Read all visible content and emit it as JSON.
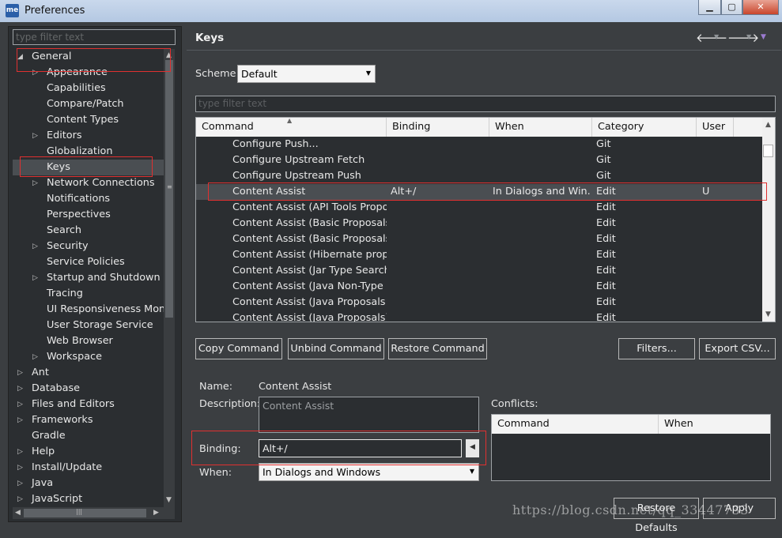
{
  "window": {
    "title": "Preferences",
    "app_icon": "me"
  },
  "left": {
    "filter_placeholder": "type filter text",
    "tree": [
      {
        "label": "General",
        "level": 0,
        "expanded": true,
        "arrow": "◢"
      },
      {
        "label": "Appearance",
        "level": 1,
        "arrow": "▷"
      },
      {
        "label": "Capabilities",
        "level": 1,
        "arrow": ""
      },
      {
        "label": "Compare/Patch",
        "level": 1,
        "arrow": ""
      },
      {
        "label": "Content Types",
        "level": 1,
        "arrow": ""
      },
      {
        "label": "Editors",
        "level": 1,
        "arrow": "▷"
      },
      {
        "label": "Globalization",
        "level": 1,
        "arrow": ""
      },
      {
        "label": "Keys",
        "level": 1,
        "arrow": "",
        "selected": true
      },
      {
        "label": "Network Connections",
        "level": 1,
        "arrow": "▷"
      },
      {
        "label": "Notifications",
        "level": 1,
        "arrow": ""
      },
      {
        "label": "Perspectives",
        "level": 1,
        "arrow": ""
      },
      {
        "label": "Search",
        "level": 1,
        "arrow": ""
      },
      {
        "label": "Security",
        "level": 1,
        "arrow": "▷"
      },
      {
        "label": "Service Policies",
        "level": 1,
        "arrow": ""
      },
      {
        "label": "Startup and Shutdown",
        "level": 1,
        "arrow": "▷"
      },
      {
        "label": "Tracing",
        "level": 1,
        "arrow": ""
      },
      {
        "label": "UI Responsiveness Monit",
        "level": 1,
        "arrow": ""
      },
      {
        "label": "User Storage Service",
        "level": 1,
        "arrow": ""
      },
      {
        "label": "Web Browser",
        "level": 1,
        "arrow": ""
      },
      {
        "label": "Workspace",
        "level": 1,
        "arrow": "▷"
      },
      {
        "label": "Ant",
        "level": 0,
        "arrow": "▷"
      },
      {
        "label": "Database",
        "level": 0,
        "arrow": "▷"
      },
      {
        "label": "Files and Editors",
        "level": 0,
        "arrow": "▷"
      },
      {
        "label": "Frameworks",
        "level": 0,
        "arrow": "▷"
      },
      {
        "label": "Gradle",
        "level": 0,
        "arrow": ""
      },
      {
        "label": "Help",
        "level": 0,
        "arrow": "▷"
      },
      {
        "label": "Install/Update",
        "level": 0,
        "arrow": "▷"
      },
      {
        "label": "Java",
        "level": 0,
        "arrow": "▷"
      },
      {
        "label": "JavaScript",
        "level": 0,
        "arrow": "▷"
      }
    ]
  },
  "main": {
    "title": "Keys",
    "scheme_label": "Scheme:",
    "scheme_value": "Default",
    "filter_placeholder": "type filter text",
    "columns": [
      "Command",
      "Binding",
      "When",
      "Category",
      "User"
    ],
    "rows": [
      {
        "command": "Configure Push...",
        "binding": "",
        "when": "",
        "category": "Git",
        "user": ""
      },
      {
        "command": "Configure Upstream Fetch",
        "binding": "",
        "when": "",
        "category": "Git",
        "user": ""
      },
      {
        "command": "Configure Upstream Push",
        "binding": "",
        "when": "",
        "category": "Git",
        "user": ""
      },
      {
        "command": "Content Assist",
        "binding": "Alt+/",
        "when": "In Dialogs and Win...",
        "category": "Edit",
        "user": "U",
        "selected": true
      },
      {
        "command": "Content Assist (API Tools Proposa",
        "binding": "",
        "when": "",
        "category": "Edit",
        "user": ""
      },
      {
        "command": "Content Assist (Basic Proposals)",
        "binding": "",
        "when": "",
        "category": "Edit",
        "user": ""
      },
      {
        "command": "Content Assist (Basic Proposals)",
        "binding": "",
        "when": "",
        "category": "Edit",
        "user": ""
      },
      {
        "command": "Content Assist (Hibernate propos",
        "binding": "",
        "when": "",
        "category": "Edit",
        "user": ""
      },
      {
        "command": "Content Assist (Jar Type Search)",
        "binding": "",
        "when": "",
        "category": "Edit",
        "user": ""
      },
      {
        "command": "Content Assist (Java Non-Type Pr",
        "binding": "",
        "when": "",
        "category": "Edit",
        "user": ""
      },
      {
        "command": "Content Assist (Java Proposals (Ta",
        "binding": "",
        "when": "",
        "category": "Edit",
        "user": ""
      },
      {
        "command": "Content Assist (Java Proposals)",
        "binding": "",
        "when": "",
        "category": "Edit",
        "user": ""
      }
    ],
    "buttons": {
      "copy": "Copy Command",
      "unbind": "Unbind Command",
      "restore": "Restore Command",
      "filters": "Filters...",
      "export": "Export CSV...",
      "restore_defaults": "Restore Defaults",
      "apply": "Apply"
    },
    "details": {
      "name_label": "Name:",
      "name_value": "Content Assist",
      "description_label": "Description:",
      "description_value": "Content Assist",
      "binding_label": "Binding:",
      "binding_value": "Alt+/",
      "when_label": "When:",
      "when_value": "In Dialogs and Windows"
    },
    "conflicts": {
      "label": "Conflicts:",
      "columns": [
        "Command",
        "When"
      ]
    }
  },
  "watermark": "https://blog.csdn.net/qq_33447733"
}
